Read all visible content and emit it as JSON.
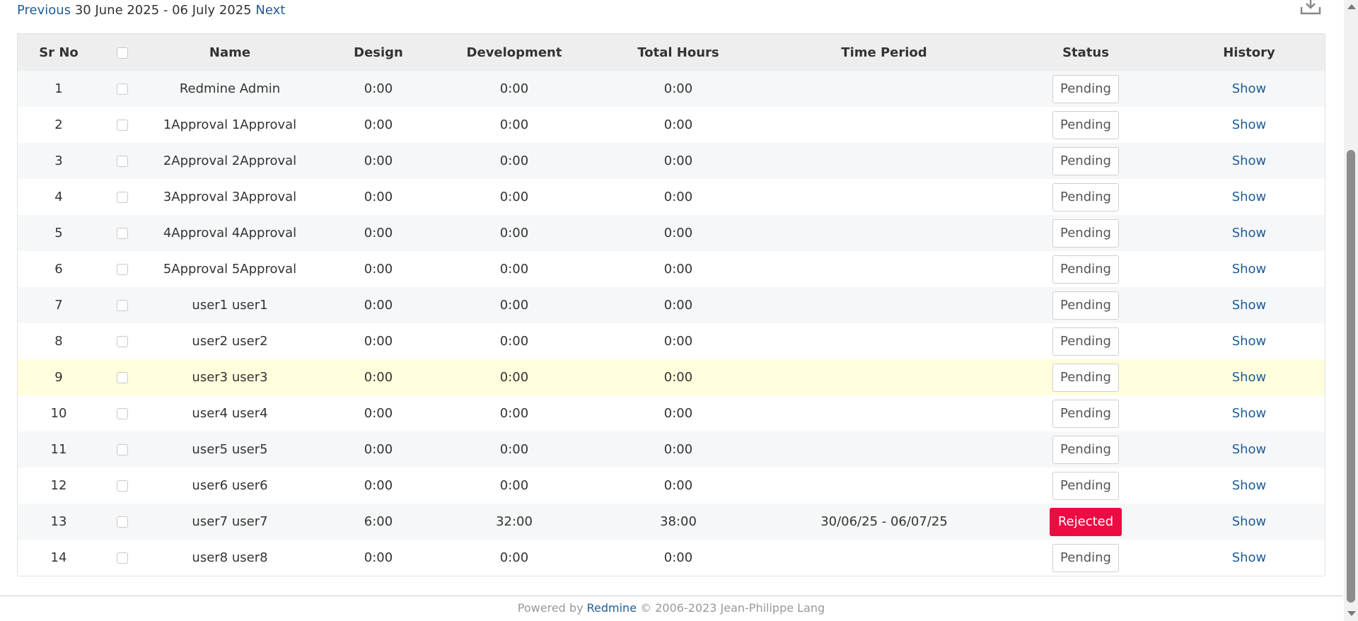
{
  "nav": {
    "previous_label": "Previous",
    "period": "30 June 2025 - 06 July 2025",
    "next_label": "Next"
  },
  "toolbar": {
    "download_icon": "download-icon"
  },
  "table": {
    "headers": {
      "sr_no": "Sr No",
      "name": "Name",
      "design": "Design",
      "development": "Development",
      "total_hours": "Total Hours",
      "time_period": "Time Period",
      "status": "Status",
      "history": "History"
    },
    "rows": [
      {
        "sr": "1",
        "name": "Redmine Admin",
        "design": "0:00",
        "development": "0:00",
        "total": "0:00",
        "period": "",
        "status": "Pending",
        "history": "Show"
      },
      {
        "sr": "2",
        "name": "1Approval 1Approval",
        "design": "0:00",
        "development": "0:00",
        "total": "0:00",
        "period": "",
        "status": "Pending",
        "history": "Show"
      },
      {
        "sr": "3",
        "name": "2Approval 2Approval",
        "design": "0:00",
        "development": "0:00",
        "total": "0:00",
        "period": "",
        "status": "Pending",
        "history": "Show"
      },
      {
        "sr": "4",
        "name": "3Approval 3Approval",
        "design": "0:00",
        "development": "0:00",
        "total": "0:00",
        "period": "",
        "status": "Pending",
        "history": "Show"
      },
      {
        "sr": "5",
        "name": "4Approval 4Approval",
        "design": "0:00",
        "development": "0:00",
        "total": "0:00",
        "period": "",
        "status": "Pending",
        "history": "Show"
      },
      {
        "sr": "6",
        "name": "5Approval 5Approval",
        "design": "0:00",
        "development": "0:00",
        "total": "0:00",
        "period": "",
        "status": "Pending",
        "history": "Show"
      },
      {
        "sr": "7",
        "name": "user1 user1",
        "design": "0:00",
        "development": "0:00",
        "total": "0:00",
        "period": "",
        "status": "Pending",
        "history": "Show"
      },
      {
        "sr": "8",
        "name": "user2 user2",
        "design": "0:00",
        "development": "0:00",
        "total": "0:00",
        "period": "",
        "status": "Pending",
        "history": "Show"
      },
      {
        "sr": "9",
        "name": "user3 user3",
        "design": "0:00",
        "development": "0:00",
        "total": "0:00",
        "period": "",
        "status": "Pending",
        "history": "Show"
      },
      {
        "sr": "10",
        "name": "user4 user4",
        "design": "0:00",
        "development": "0:00",
        "total": "0:00",
        "period": "",
        "status": "Pending",
        "history": "Show"
      },
      {
        "sr": "11",
        "name": "user5 user5",
        "design": "0:00",
        "development": "0:00",
        "total": "0:00",
        "period": "",
        "status": "Pending",
        "history": "Show"
      },
      {
        "sr": "12",
        "name": "user6 user6",
        "design": "0:00",
        "development": "0:00",
        "total": "0:00",
        "period": "",
        "status": "Pending",
        "history": "Show"
      },
      {
        "sr": "13",
        "name": "user7 user7",
        "design": "6:00",
        "development": "32:00",
        "total": "38:00",
        "period": "30/06/25 - 06/07/25",
        "status": "Rejected",
        "history": "Show"
      },
      {
        "sr": "14",
        "name": "user8 user8",
        "design": "0:00",
        "development": "0:00",
        "total": "0:00",
        "period": "",
        "status": "Pending",
        "history": "Show"
      }
    ]
  },
  "footer": {
    "powered_by": "Powered by",
    "link": "Redmine",
    "copyright": "© 2006-2023 Jean-Philippe Lang"
  },
  "colors": {
    "link": "#1f5c96",
    "rejected": "#ec0b43",
    "highlight_row": "#ffffdd"
  }
}
